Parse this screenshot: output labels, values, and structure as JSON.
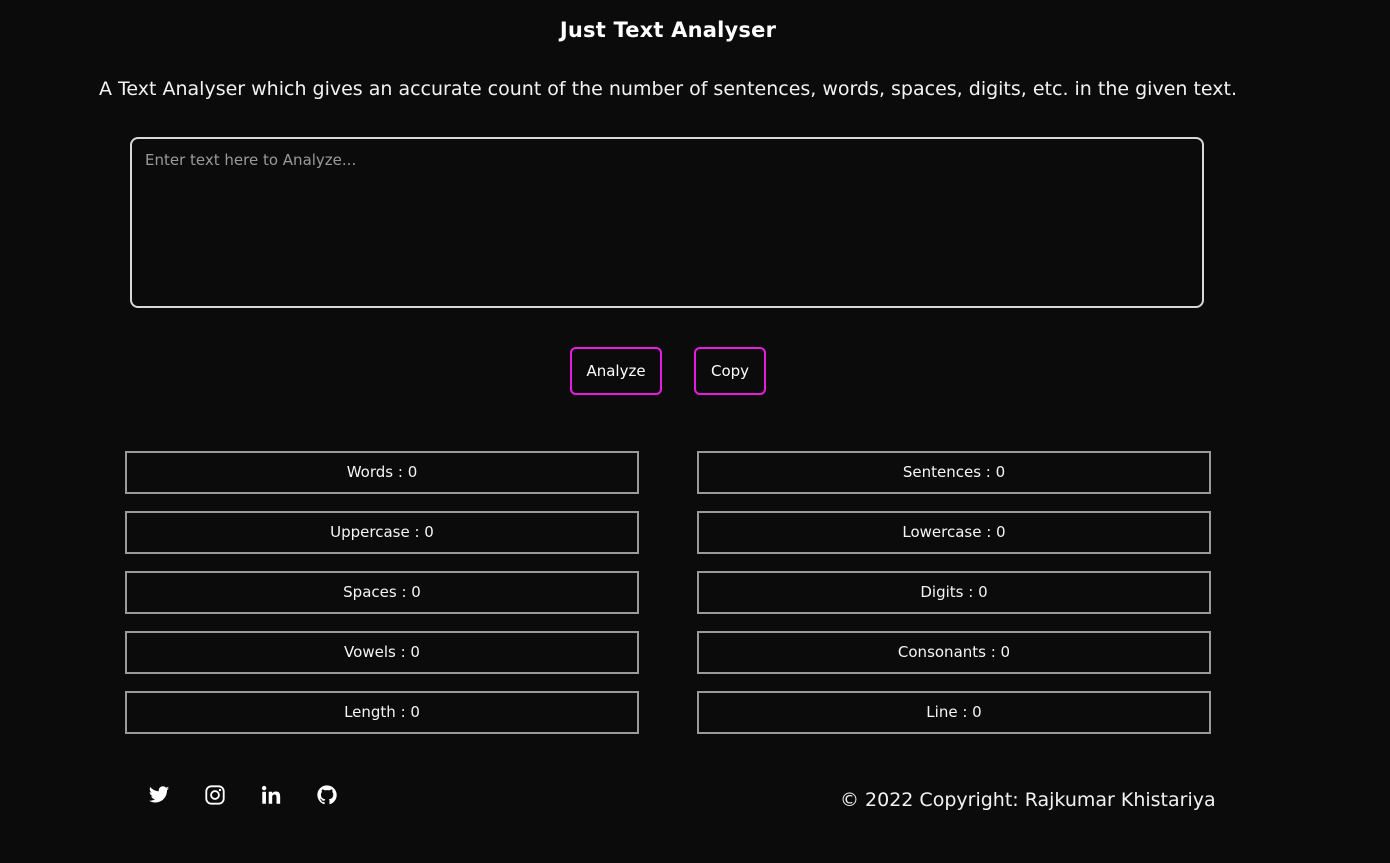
{
  "header": {
    "title": "Just Text Analyser",
    "subtitle": "A Text Analyser which gives an accurate count of the number of sentences, words, spaces, digits, etc. in the given text."
  },
  "input": {
    "value": "",
    "placeholder": "Enter text here to Analyze..."
  },
  "buttons": {
    "analyze_label": "Analyze",
    "copy_label": "Copy"
  },
  "stats": [
    {
      "label": "Words : 0"
    },
    {
      "label": "Sentences : 0"
    },
    {
      "label": "Uppercase : 0"
    },
    {
      "label": "Lowercase : 0"
    },
    {
      "label": "Spaces : 0"
    },
    {
      "label": "Digits : 0"
    },
    {
      "label": "Vowels : 0"
    },
    {
      "label": "Consonants : 0"
    },
    {
      "label": "Length : 0"
    },
    {
      "label": "Line : 0"
    }
  ],
  "footer": {
    "social_icons": [
      "twitter-icon",
      "instagram-icon",
      "linkedin-icon",
      "github-icon"
    ],
    "copyright": "© 2022 Copyright: Rajkumar Khistariya"
  },
  "colors": {
    "background": "#0b0b0b",
    "button_border": "#e81ce0",
    "stat_border": "#9a9a9a",
    "textarea_border": "#d8d8d8"
  }
}
